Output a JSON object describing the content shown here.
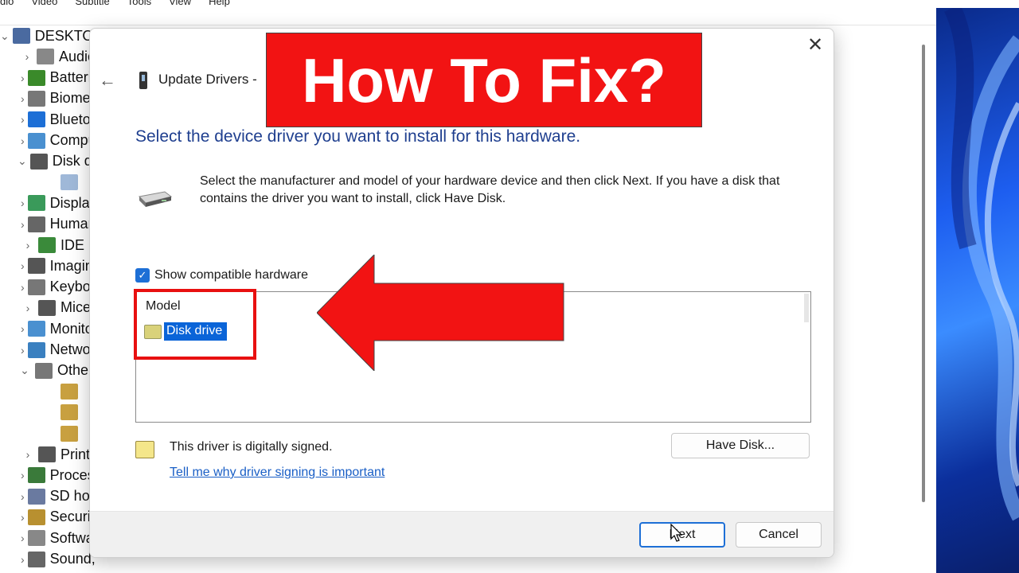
{
  "background": {
    "menu": [
      "dio",
      "Video",
      "Subtitle",
      "Tools",
      "View",
      "Help"
    ],
    "tree": [
      {
        "label": "DESKTOP",
        "chevron": "open-root",
        "icon": "computer-icon",
        "color": "#4a6aa0"
      },
      {
        "label": "Audio",
        "chevron": "closed",
        "icon": "speaker-icon",
        "color": "#888888"
      },
      {
        "label": "Batteries",
        "chevron": "closed",
        "icon": "battery-icon",
        "color": "#3a8a2a"
      },
      {
        "label": "Biometric",
        "chevron": "closed",
        "icon": "fingerprint-icon",
        "color": "#777777"
      },
      {
        "label": "Bluetooth",
        "chevron": "closed",
        "icon": "bluetooth-icon",
        "color": "#1d6fd6"
      },
      {
        "label": "Computer",
        "chevron": "closed",
        "icon": "monitor-icon",
        "color": "#4a90d0"
      },
      {
        "label": "Disk drives",
        "chevron": "open",
        "icon": "disk-icon",
        "color": "#555555"
      },
      {
        "label": "",
        "chevron": "none",
        "icon": "disk-icon",
        "color": "#9fb8d8"
      },
      {
        "label": "Display",
        "chevron": "closed",
        "icon": "display-icon",
        "color": "#3a9a5a"
      },
      {
        "label": "Human",
        "chevron": "closed",
        "icon": "hid-icon",
        "color": "#666666"
      },
      {
        "label": "IDE",
        "chevron": "closed",
        "icon": "ide-icon",
        "color": "#3a8a3a"
      },
      {
        "label": "Imaging",
        "chevron": "closed",
        "icon": "camera-icon",
        "color": "#555555"
      },
      {
        "label": "Keyboards",
        "chevron": "closed",
        "icon": "keyboard-icon",
        "color": "#777777"
      },
      {
        "label": "Mice",
        "chevron": "closed",
        "icon": "mouse-icon",
        "color": "#555555"
      },
      {
        "label": "Monitors",
        "chevron": "closed",
        "icon": "monitor-icon",
        "color": "#4a90d0"
      },
      {
        "label": "Network",
        "chevron": "closed",
        "icon": "network-icon",
        "color": "#3a80c0"
      },
      {
        "label": "Other",
        "chevron": "open",
        "icon": "question-icon",
        "color": "#777777"
      },
      {
        "label": "",
        "chevron": "none",
        "icon": "warning-device-icon",
        "color": "#c8a040"
      },
      {
        "label": "",
        "chevron": "none",
        "icon": "warning-device-icon",
        "color": "#c8a040"
      },
      {
        "label": "",
        "chevron": "none",
        "icon": "warning-device-icon",
        "color": "#c8a040"
      },
      {
        "label": "Print",
        "chevron": "closed",
        "icon": "printer-icon",
        "color": "#555555"
      },
      {
        "label": "Processors",
        "chevron": "closed",
        "icon": "chip-icon",
        "color": "#3a7a3a"
      },
      {
        "label": "SD host",
        "chevron": "closed",
        "icon": "sd-icon",
        "color": "#6a7aa0"
      },
      {
        "label": "Security",
        "chevron": "closed",
        "icon": "security-icon",
        "color": "#b89030"
      },
      {
        "label": "Software",
        "chevron": "closed",
        "icon": "software-icon",
        "color": "#888888"
      },
      {
        "label": "Sound, video and game controllers",
        "chevron": "closed",
        "icon": "speaker-icon",
        "color": "#666666"
      }
    ]
  },
  "dialog": {
    "close": "✕",
    "back": "←",
    "title": "Update Drivers -",
    "heading": "Select the device driver you want to install for this hardware.",
    "description": "Select the manufacturer and model of your hardware device and then click Next. If you have a disk that contains the driver you want to install, click Have Disk.",
    "show_compatible": "Show compatible hardware",
    "model_header": "Model",
    "model_item": "Disk drive",
    "signed_text": "This driver is digitally signed.",
    "signed_link": "Tell me why driver signing is important",
    "have_disk": "Have Disk...",
    "next": "Next",
    "cancel": "Cancel"
  },
  "overlay": {
    "banner": "How To Fix?",
    "banner_color": "#f21313",
    "highlight_color": "#e81010"
  }
}
